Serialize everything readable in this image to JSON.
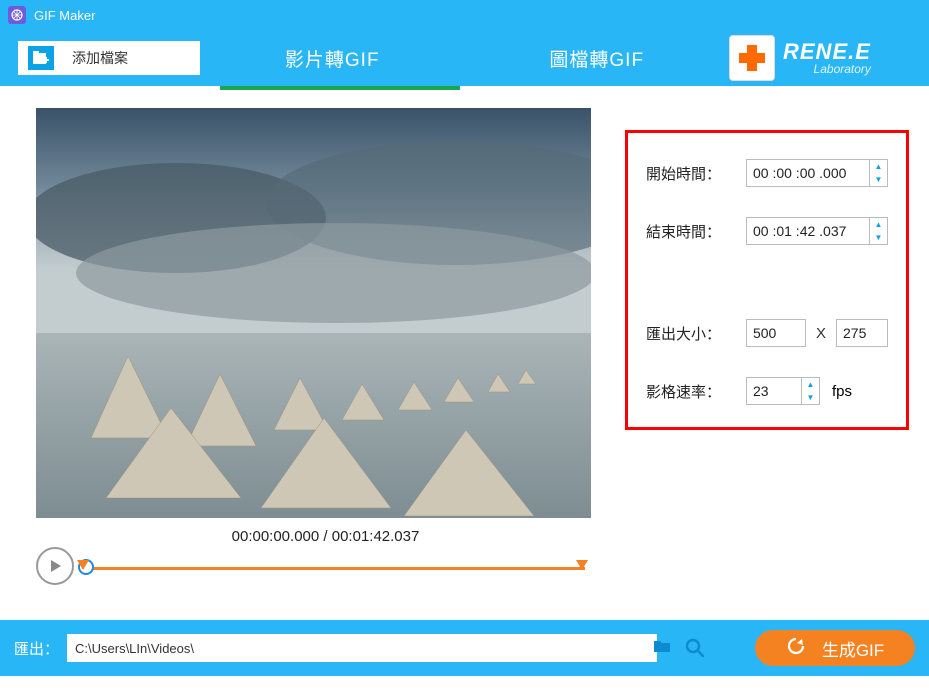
{
  "app": {
    "title": "GIF Maker"
  },
  "logo": {
    "brand": "RENE.E",
    "sub": "Laboratory"
  },
  "tabs": {
    "add_file": "添加檔案",
    "video_to_gif": "影片轉GIF",
    "image_to_gif": "圖檔轉GIF"
  },
  "preview": {
    "current_time": "00:00:00.000",
    "separator": " / ",
    "total_time": "00:01:42.037"
  },
  "settings": {
    "start_label": "開始時間：",
    "start_value": "00 :00 :00 .000",
    "end_label": "結束時間：",
    "end_value": "00 :01 :42 .037",
    "size_label": "匯出大小：",
    "size_w": "500",
    "size_x": "X",
    "size_h": "275",
    "fps_label": "影格速率：",
    "fps_value": "23",
    "fps_unit": "fps"
  },
  "output": {
    "label": "匯出：",
    "path": "C:\\Users\\LIn\\Videos\\"
  },
  "generate": {
    "label": "生成GIF"
  }
}
